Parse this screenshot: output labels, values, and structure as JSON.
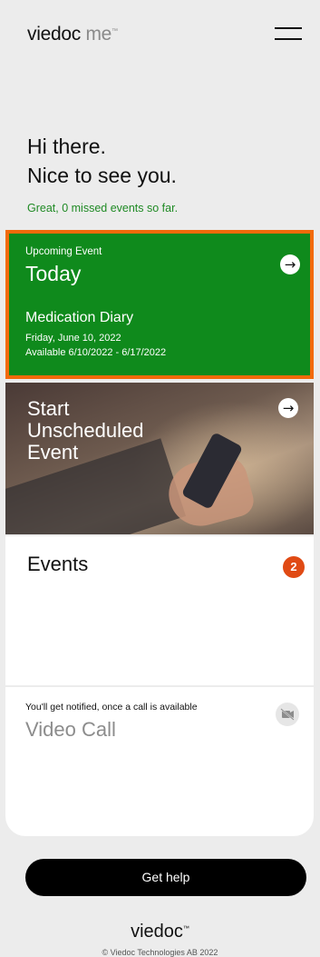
{
  "header": {
    "logo_main": "viedoc",
    "logo_sub": "me",
    "logo_tm": "™",
    "menu_icon": "hamburger-menu-icon"
  },
  "greeting": {
    "line1": "Hi there.",
    "line2": "Nice to see you.",
    "missed": "Great, 0 missed events so far."
  },
  "upcoming": {
    "label": "Upcoming Event",
    "title": "Today",
    "event_name": "Medication Diary",
    "date": "Friday, June 10, 2022",
    "available": "Available 6/10/2022 - 6/17/2022",
    "arrow": "→",
    "bg_color": "#0f8a1c",
    "highlight_color": "#f26a0a"
  },
  "unscheduled": {
    "line1": "Start",
    "line2": "Unscheduled",
    "line3": "Event",
    "arrow": "→"
  },
  "events": {
    "title": "Events",
    "badge": "2",
    "badge_color": "#e04a14"
  },
  "video_call": {
    "note": "You'll get notified, once a call is available",
    "title": "Video Call",
    "icon": "video-off-icon"
  },
  "help": {
    "label": "Get help"
  },
  "footer": {
    "logo": "viedoc",
    "logo_tm": "™",
    "copyright": "© Viedoc Technologies AB 2022"
  }
}
